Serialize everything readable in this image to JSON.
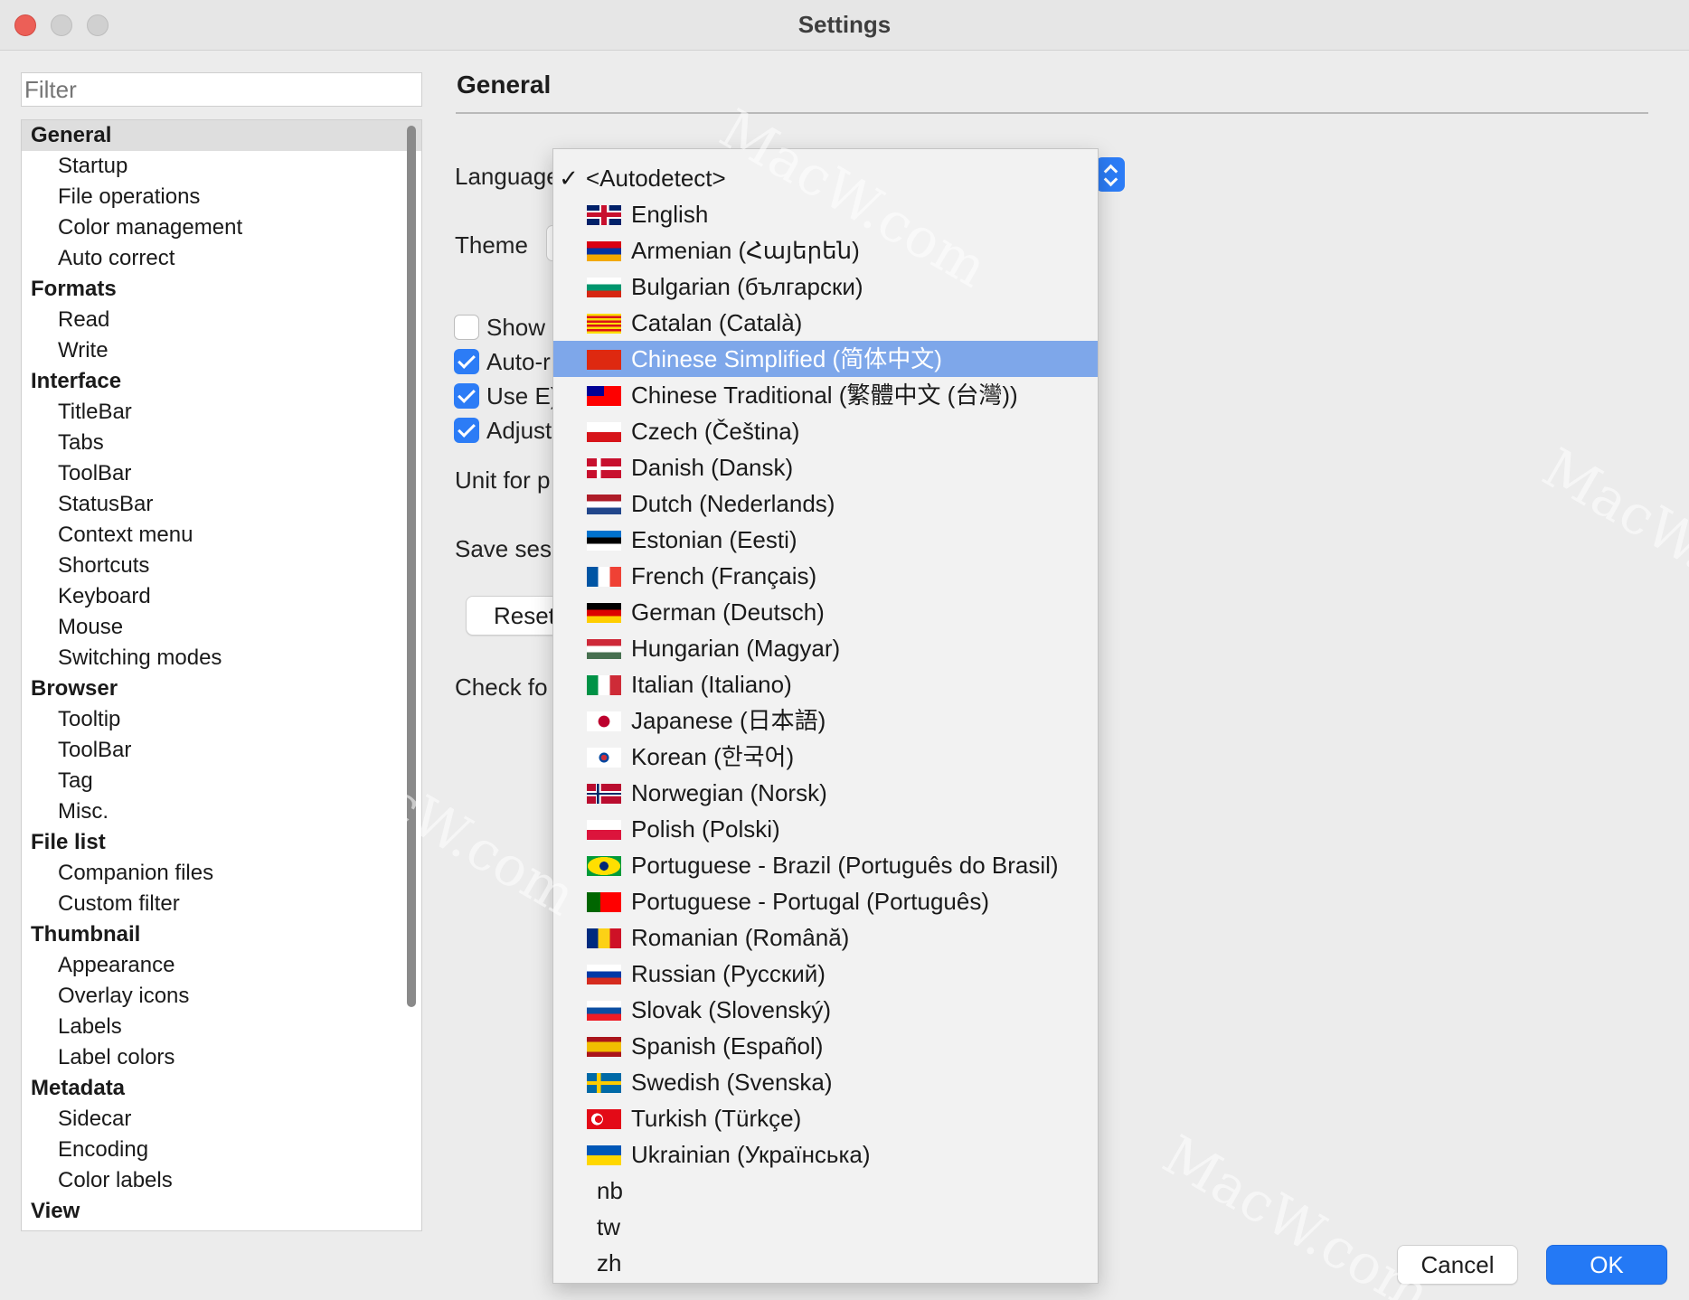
{
  "window": {
    "title": "Settings"
  },
  "sidebar": {
    "filter_placeholder": "Filter",
    "items": [
      {
        "label": "General",
        "group": true,
        "selected": true
      },
      {
        "label": "Startup"
      },
      {
        "label": "File operations"
      },
      {
        "label": "Color management"
      },
      {
        "label": "Auto correct"
      },
      {
        "label": "Formats",
        "group": true
      },
      {
        "label": "Read"
      },
      {
        "label": "Write"
      },
      {
        "label": "Interface",
        "group": true
      },
      {
        "label": "TitleBar"
      },
      {
        "label": "Tabs"
      },
      {
        "label": "ToolBar"
      },
      {
        "label": "StatusBar"
      },
      {
        "label": "Context menu"
      },
      {
        "label": "Shortcuts"
      },
      {
        "label": "Keyboard"
      },
      {
        "label": "Mouse"
      },
      {
        "label": "Switching modes"
      },
      {
        "label": "Browser",
        "group": true
      },
      {
        "label": "Tooltip"
      },
      {
        "label": "ToolBar"
      },
      {
        "label": "Tag"
      },
      {
        "label": "Misc."
      },
      {
        "label": "File list",
        "group": true
      },
      {
        "label": "Companion files"
      },
      {
        "label": "Custom filter"
      },
      {
        "label": "Thumbnail",
        "group": true
      },
      {
        "label": "Appearance"
      },
      {
        "label": "Overlay icons"
      },
      {
        "label": "Labels"
      },
      {
        "label": "Label colors"
      },
      {
        "label": "Metadata",
        "group": true
      },
      {
        "label": "Sidecar"
      },
      {
        "label": "Encoding"
      },
      {
        "label": "Color labels"
      },
      {
        "label": "View",
        "group": true
      }
    ]
  },
  "main": {
    "section_title": "General",
    "language_label": "Language",
    "theme_label": "Theme",
    "checkboxes": [
      {
        "label": "Show",
        "checked": false
      },
      {
        "label": "Auto-r",
        "checked": true
      },
      {
        "label": "Use E)",
        "checked": true
      },
      {
        "label": "Adjust",
        "checked": true
      }
    ],
    "unit_label": "Unit for p",
    "save_label": "Save ses:",
    "reset_label": "Reset",
    "check_label": "Check fo"
  },
  "language_menu": {
    "items": [
      {
        "label": "<Autodetect>",
        "checked": true,
        "flag": "none"
      },
      {
        "label": "English",
        "flag": "gb"
      },
      {
        "label": "Armenian (Հայերեն)",
        "flag": "am"
      },
      {
        "label": "Bulgarian (български)",
        "flag": "bg"
      },
      {
        "label": "Catalan (Català)",
        "flag": "ct"
      },
      {
        "label": "Chinese Simplified (简体中文)",
        "flag": "cn",
        "highlighted": true
      },
      {
        "label": "Chinese Traditional (繁體中文 (台灣))",
        "flag": "tw"
      },
      {
        "label": "Czech (Čeština)",
        "flag": "cz"
      },
      {
        "label": "Danish (Dansk)",
        "flag": "dk"
      },
      {
        "label": "Dutch (Nederlands)",
        "flag": "nl"
      },
      {
        "label": "Estonian (Eesti)",
        "flag": "ee"
      },
      {
        "label": "French (Français)",
        "flag": "fr"
      },
      {
        "label": "German (Deutsch)",
        "flag": "de"
      },
      {
        "label": "Hungarian (Magyar)",
        "flag": "hu"
      },
      {
        "label": "Italian (Italiano)",
        "flag": "it"
      },
      {
        "label": "Japanese (日本語)",
        "flag": "jp"
      },
      {
        "label": "Korean (한국어)",
        "flag": "kr"
      },
      {
        "label": "Norwegian (Norsk)",
        "flag": "no"
      },
      {
        "label": "Polish (Polski)",
        "flag": "pl"
      },
      {
        "label": "Portuguese - Brazil (Português do Brasil)",
        "flag": "br"
      },
      {
        "label": "Portuguese - Portugal (Português)",
        "flag": "pt"
      },
      {
        "label": "Romanian (Română)",
        "flag": "ro"
      },
      {
        "label": "Russian (Русский)",
        "flag": "ru"
      },
      {
        "label": "Slovak (Slovenský)",
        "flag": "sk"
      },
      {
        "label": "Spanish (Español)",
        "flag": "es"
      },
      {
        "label": "Swedish (Svenska)",
        "flag": "se"
      },
      {
        "label": "Turkish (Türkçe)",
        "flag": "tr"
      },
      {
        "label": "Ukrainian (Українська)",
        "flag": "ua"
      },
      {
        "label": "nb",
        "flag": "none"
      },
      {
        "label": "tw",
        "flag": "none"
      },
      {
        "label": "zh",
        "flag": "none"
      }
    ]
  },
  "footer": {
    "cancel_label": "Cancel",
    "ok_label": "OK"
  },
  "colors": {
    "accent": "#2c7cf6",
    "highlight": "#7ea7ea",
    "ok_button": "#2479f5"
  },
  "watermark": "MacW.com"
}
